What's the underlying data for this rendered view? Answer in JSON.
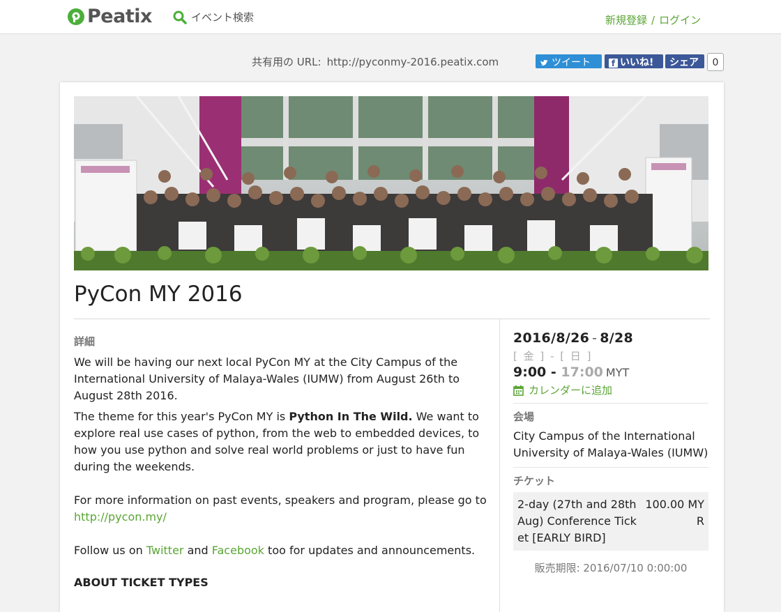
{
  "header": {
    "logo_text": "Peatix",
    "search_label": "イベント検索",
    "signup_label": "新規登録",
    "separator": "/",
    "login_label": "ログイン"
  },
  "share": {
    "url_label": "共有用の URL:",
    "url": "http://pyconmy-2016.peatix.com",
    "tweet_label": "ツイート",
    "like_label": "いいね!",
    "share_label": "シェア",
    "share_count": "0"
  },
  "event": {
    "title": "PyCon MY 2016",
    "details_heading": "詳細",
    "desc_p1": "We will be having our next local PyCon MY at the City Campus of the International University of Malaya-Wales (IUMW) from August 26th to August 28th 2016.",
    "desc_p2_before": "The theme for this year's PyCon MY is ",
    "desc_p2_bold": "Python In The Wild.",
    "desc_p2_after": " We want to explore real use cases of python, from the web to embedded devices, to how you use python and solve real world problems or just to have fun during the weekends.",
    "desc_p3_before": "For more information on past events, speakers and program, please go to ",
    "desc_p3_link": "http://pycon.my/",
    "desc_p4_before": "Follow us on ",
    "desc_p4_link1": "Twitter",
    "desc_p4_mid": " and ",
    "desc_p4_link2": "Facebook",
    "desc_p4_after": " too for updates and announcements.",
    "ticket_types_heading": "ABOUT TICKET TYPES"
  },
  "schedule": {
    "start_date": "2016/8/26",
    "date_separator": "-",
    "end_date": "8/28",
    "weekdays": "[ 金 ] - [ 日 ]",
    "start_time": "9:00",
    "time_separator": "-",
    "end_time": "17:00",
    "timezone": "MYT",
    "calendar_label": "カレンダーに追加"
  },
  "venue": {
    "heading": "会場",
    "name": "City Campus of the International University of Malaya-Wales (IUMW)"
  },
  "tickets": {
    "heading": "チケット",
    "items": [
      {
        "name": "2-day (27th and 28th Aug) Conference Ticket [EARLY BIRD]",
        "price": "100.00 MYR"
      }
    ],
    "sale_until": "販売期限: 2016/07/10 0:00:00"
  },
  "colors": {
    "brand_green": "#5aa534",
    "twitter_blue": "#2f8fd6",
    "facebook_blue": "#3b5898"
  },
  "icons": [
    "peatix-logo-icon",
    "search-icon",
    "twitter-bird-icon",
    "facebook-f-icon",
    "calendar-add-icon"
  ]
}
